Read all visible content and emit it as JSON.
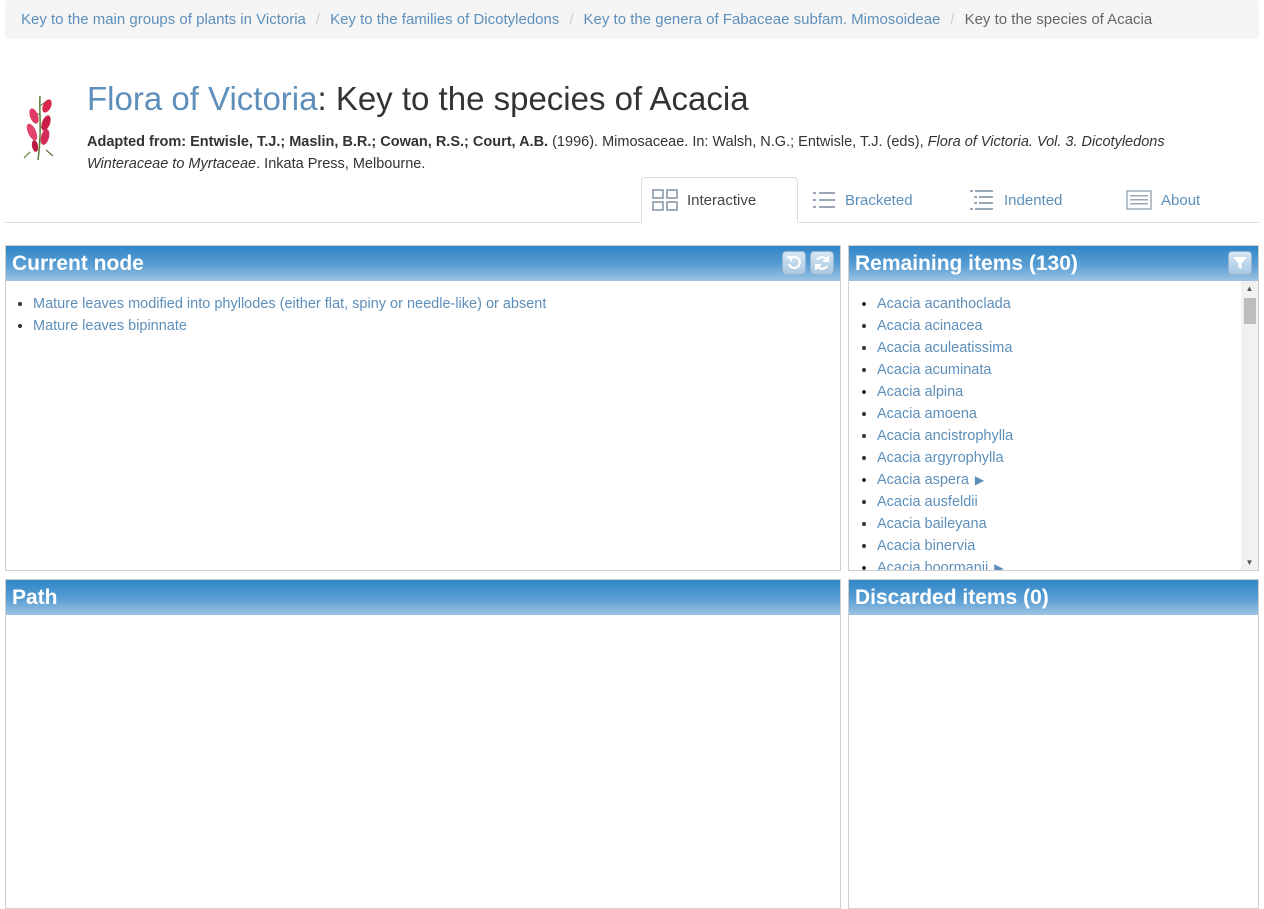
{
  "breadcrumb": {
    "items": [
      "Key to the main groups of plants in Victoria",
      "Key to the families of Dicotyledons",
      "Key to the genera of Fabaceae subfam. Mimosoideae"
    ],
    "current": "Key to the species of Acacia"
  },
  "header": {
    "title_link": "Flora of Victoria",
    "title_rest": ": Key to the species of Acacia",
    "citation": {
      "prefix_bold": "Adapted from: Entwisle, T.J.; Maslin, B.R.; Cowan, R.S.; Court, A.B.",
      "middle": " (1996). Mimosaceae. In: Walsh, N.G.; Entwisle, T.J. (eds), ",
      "italic": "Flora of Victoria. Vol. 3. Dicotyledons Winteraceae to Myrtaceae",
      "suffix": ". Inkata Press, Melbourne."
    }
  },
  "tabs": {
    "interactive": "Interactive",
    "bracketed": "Bracketed",
    "indented": "Indented",
    "about": "About"
  },
  "current_node": {
    "title": "Current node",
    "items": [
      "Mature leaves modified into phyllodes (either flat, spiny or needle-like) or absent",
      "Mature leaves bipinnate"
    ]
  },
  "remaining": {
    "title": "Remaining items (130)",
    "items": [
      "Acacia acanthoclada",
      "Acacia acinacea",
      "Acacia aculeatissima",
      "Acacia acuminata",
      "Acacia alpina",
      "Acacia amoena",
      "Acacia ancistrophylla",
      "Acacia argyrophylla",
      "Acacia aspera",
      "Acacia ausfeldii",
      "Acacia baileyana",
      "Acacia binervia",
      "Acacia boormanii"
    ]
  },
  "path": {
    "title": "Path"
  },
  "discarded": {
    "title": "Discarded items (0)"
  },
  "colors": {
    "link": "#5d8fba",
    "panel_header": "#2f86c8"
  }
}
